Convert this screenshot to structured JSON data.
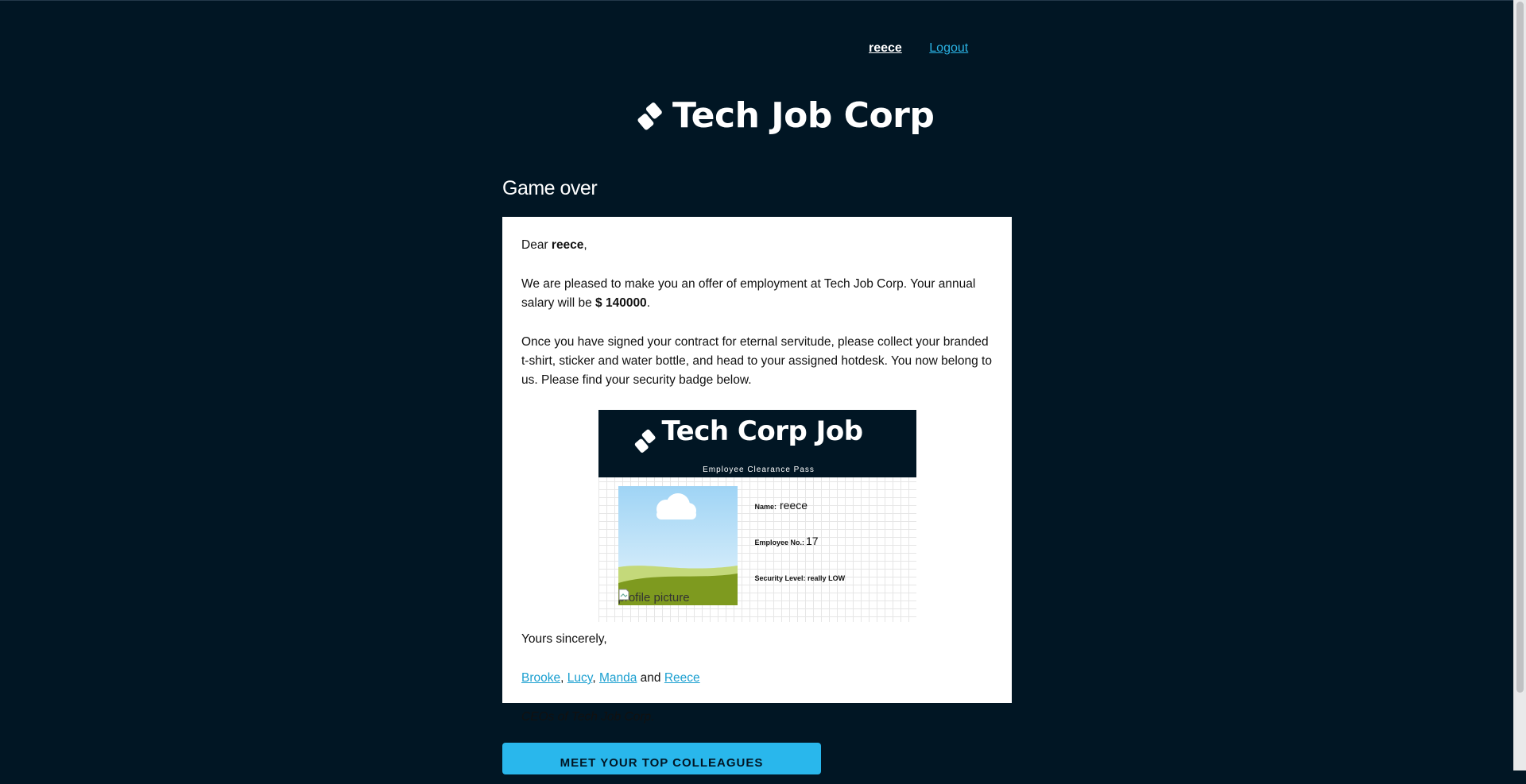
{
  "nav": {
    "username": "reece",
    "logout_label": "Logout"
  },
  "brand": {
    "name": "Tech Job Corp"
  },
  "page": {
    "title": "Game over"
  },
  "letter": {
    "greeting_prefix": "Dear ",
    "recipient": "reece",
    "greeting_suffix": ",",
    "offer_text": "We are pleased to make you an offer of employment at Tech Job Corp. Your annual salary will be ",
    "salary": "$ 140000",
    "offer_suffix": ".",
    "contract_text": "Once you have signed your contract for eternal servitude, please collect your branded t-shirt, sticker and water bottle, and head to your assigned hotdesk. You now belong to us. Please find your security badge below.",
    "closing": "Yours sincerely,",
    "ceos": [
      "Brooke",
      "Lucy",
      "Manda",
      "Reece"
    ],
    "sep_comma": ", ",
    "sep_and": " and ",
    "ceo_title": "CEOs of Tech Job Corp."
  },
  "badge": {
    "company": "Tech Corp Job",
    "subtitle": "Employee Clearance Pass",
    "photo_alt": "profile picture",
    "name_label": "Name:",
    "name_value": "reece",
    "employee_no_label": "Employee No.:",
    "employee_no_value": "17",
    "security_label": "Security Level:",
    "security_value": "really LOW"
  },
  "cta": {
    "label": "MEET YOUR TOP COLLEAGUES"
  },
  "colors": {
    "background": "#011624",
    "accent": "#29b7ec",
    "link": "#1a9fd0"
  }
}
